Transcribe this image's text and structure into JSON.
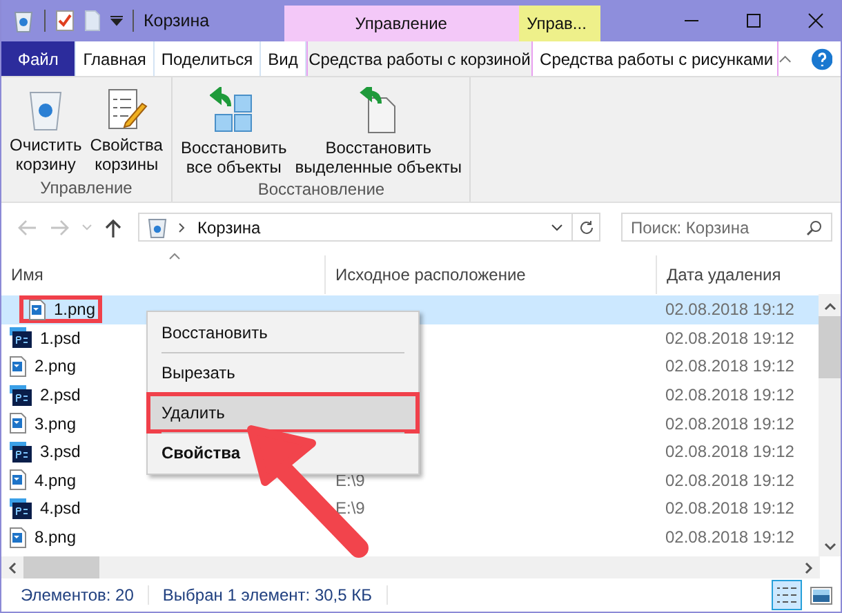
{
  "window": {
    "title": "Корзина"
  },
  "context_tabs": [
    {
      "label": "Управление",
      "color": "#f3c8f8"
    },
    {
      "label": "Управ...",
      "color": "#eef08a"
    }
  ],
  "ribbon_tabs": [
    {
      "kind": "file",
      "label": "Файл",
      "selected": false
    },
    {
      "kind": "tab",
      "label": "Главная",
      "selected": false
    },
    {
      "kind": "tab",
      "label": "Поделиться",
      "selected": false
    },
    {
      "kind": "tab",
      "label": "Вид",
      "selected": false
    },
    {
      "kind": "tab",
      "label": "Средства работы с корзиной",
      "selected": true
    },
    {
      "kind": "tab",
      "label": "Средства работы с рисунками",
      "selected": false
    }
  ],
  "ribbon_groups": [
    {
      "label": "Управление",
      "buttons": [
        {
          "kind": "bin",
          "lines": [
            "Очистить",
            "корзину"
          ]
        },
        {
          "kind": "properties",
          "lines": [
            "Свойства",
            "корзины"
          ]
        }
      ]
    },
    {
      "label": "Восстановление",
      "buttons": [
        {
          "kind": "restore-all",
          "lines": [
            "Восстановить",
            "все объекты"
          ]
        },
        {
          "kind": "restore-selected",
          "lines": [
            "Восстановить",
            "выделенные объекты"
          ]
        }
      ]
    }
  ],
  "address": {
    "location": "Корзина"
  },
  "search": {
    "placeholder": "Поиск: Корзина"
  },
  "columns": [
    "Имя",
    "Исходное расположение",
    "Дата удаления"
  ],
  "rows": [
    {
      "kind": "png",
      "name": "1.png",
      "date": "02.08.2018 19:12",
      "selected": true,
      "marked": true
    },
    {
      "kind": "psd",
      "name": "1.psd",
      "date": "02.08.2018 19:12",
      "selected": false,
      "marked": false
    },
    {
      "kind": "png",
      "name": "2.png",
      "date": "02.08.2018 19:12",
      "selected": false,
      "marked": false
    },
    {
      "kind": "psd",
      "name": "2.psd",
      "date": "02.08.2018 19:12",
      "selected": false,
      "marked": false
    },
    {
      "kind": "png",
      "name": "3.png",
      "date": "02.08.2018 19:12",
      "selected": false,
      "marked": false
    },
    {
      "kind": "psd",
      "name": "3.psd",
      "date": "02.08.2018 19:12",
      "selected": false,
      "marked": false
    },
    {
      "kind": "png",
      "name": "4.png",
      "origin": "E:\\9",
      "date": "02.08.2018 19:12",
      "selected": false,
      "marked": false
    },
    {
      "kind": "psd",
      "name": "4.psd",
      "origin": "E:\\9",
      "date": "02.08.2018 19:12",
      "selected": false,
      "marked": false
    },
    {
      "kind": "png",
      "name": "8.png",
      "date": "02.08.2018 19:12",
      "selected": false,
      "marked": false
    }
  ],
  "context_menu": [
    {
      "kind": "normal",
      "label": "Восстановить",
      "selected": false
    },
    {
      "kind": "normal",
      "label": "Вырезать",
      "selected": false
    },
    {
      "kind": "normal",
      "label": "Удалить",
      "selected": true
    },
    {
      "kind": "bold",
      "label": "Свойства",
      "selected": false
    }
  ],
  "status_bar": [
    "Элементов: 20",
    "Выбран 1 элемент: 30,5 КБ"
  ],
  "view_buttons": [
    {
      "kind": "details",
      "selected": true
    },
    {
      "kind": "thumbnails",
      "selected": false
    }
  ]
}
